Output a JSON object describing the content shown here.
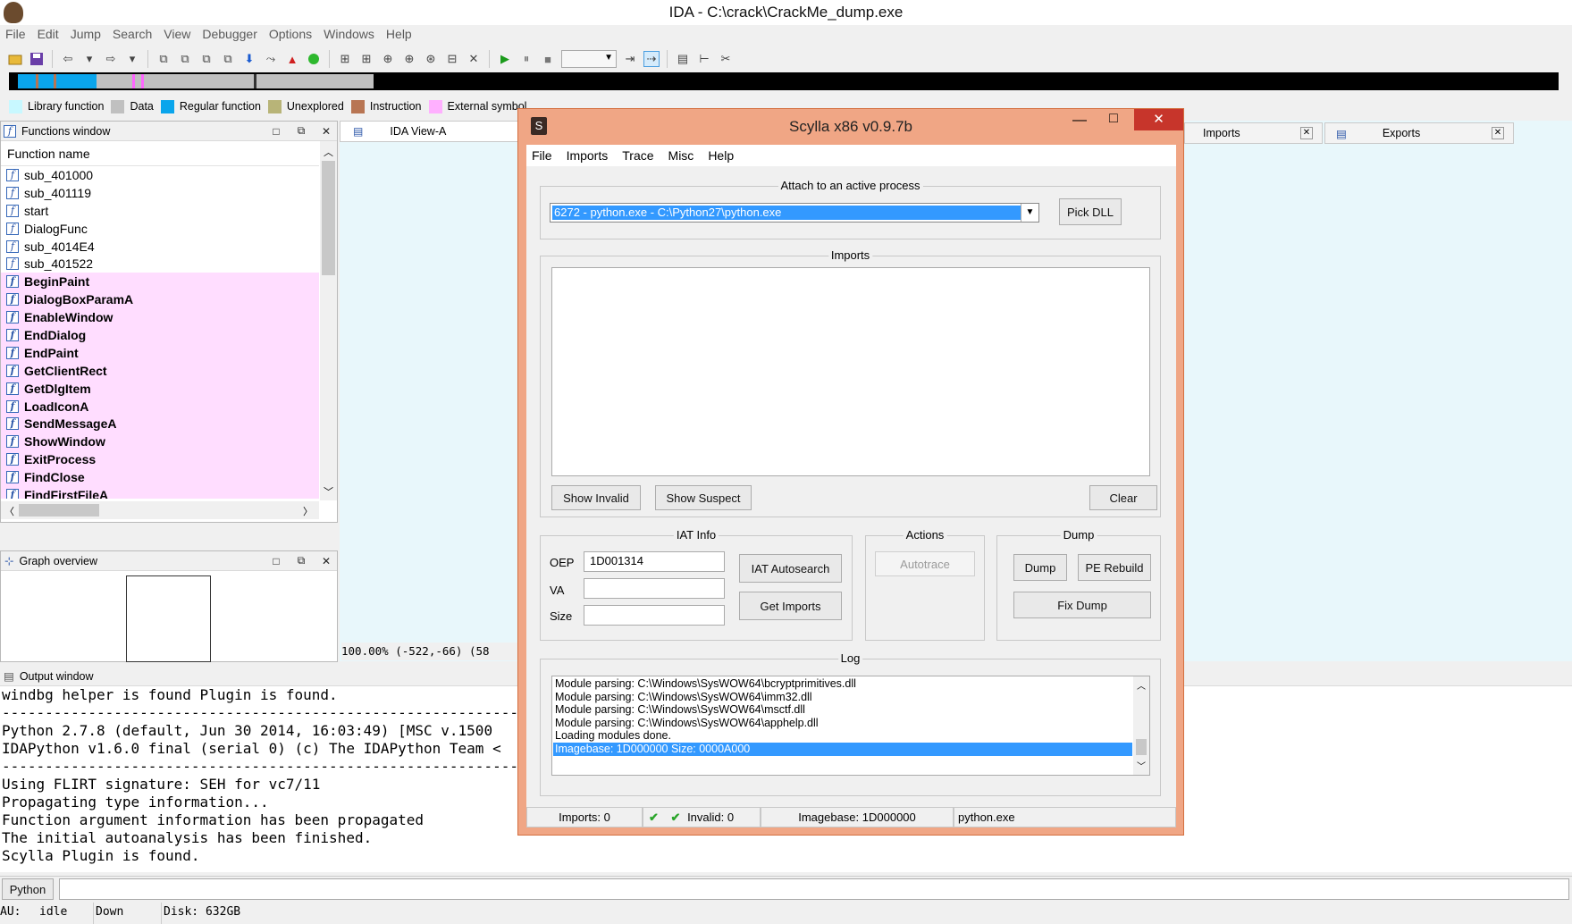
{
  "window": {
    "title": "IDA - C:\\crack\\CrackMe_dump.exe"
  },
  "menu": [
    "File",
    "Edit",
    "Jump",
    "Search",
    "View",
    "Debugger",
    "Options",
    "Windows",
    "Help"
  ],
  "legend": [
    {
      "label": "Library function",
      "color": "#c8f8ff"
    },
    {
      "label": "Data",
      "color": "#c0c0c0"
    },
    {
      "label": "Regular function",
      "color": "#0aa5ec"
    },
    {
      "label": "Unexplored",
      "color": "#b8b478"
    },
    {
      "label": "Instruction",
      "color": "#b87553"
    },
    {
      "label": "External symbol",
      "color": "#ffb0ff"
    }
  ],
  "functions_window": {
    "title": "Functions window",
    "column": "Function name",
    "items": [
      {
        "name": "sub_401000",
        "imported": false
      },
      {
        "name": "sub_401119",
        "imported": false
      },
      {
        "name": "start",
        "imported": false
      },
      {
        "name": "DialogFunc",
        "imported": false
      },
      {
        "name": "sub_4014E4",
        "imported": false
      },
      {
        "name": "sub_401522",
        "imported": false
      },
      {
        "name": "BeginPaint",
        "imported": true
      },
      {
        "name": "DialogBoxParamA",
        "imported": true
      },
      {
        "name": "EnableWindow",
        "imported": true
      },
      {
        "name": "EndDialog",
        "imported": true
      },
      {
        "name": "EndPaint",
        "imported": true
      },
      {
        "name": "GetClientRect",
        "imported": true
      },
      {
        "name": "GetDlgItem",
        "imported": true
      },
      {
        "name": "LoadIconA",
        "imported": true
      },
      {
        "name": "SendMessageA",
        "imported": true
      },
      {
        "name": "ShowWindow",
        "imported": true
      },
      {
        "name": "ExitProcess",
        "imported": true
      },
      {
        "name": "FindClose",
        "imported": true
      },
      {
        "name": "FindFirstFileA",
        "imported": true
      }
    ]
  },
  "graph_overview": {
    "title": "Graph overview"
  },
  "tabs": {
    "ida_view": "IDA View-A",
    "imports": "Imports",
    "exports": "Exports"
  },
  "ida_status": "100.00% (-522,-66) (58",
  "output": {
    "title": "Output window",
    "lines": [
      "windbg helper is found Plugin is found.",
      "---------------------------------------------------------------------------------------",
      "Python 2.7.8 (default, Jun 30 2014, 16:03:49) [MSC v.1500",
      "IDAPython v1.6.0 final (serial 0) (c) The IDAPython Team <",
      "---------------------------------------------------------------------------------------",
      "Using FLIRT signature: SEH for vc7/11",
      "Propagating type information...",
      "Function argument information has been propagated",
      "The initial autoanalysis has been finished.",
      "Scylla Plugin is found."
    ]
  },
  "python_button": "Python",
  "statusbar": {
    "au": "AU:",
    "state": "idle",
    "dir": "Down",
    "disk": "Disk: 632GB"
  },
  "scylla": {
    "title": "Scylla x86 v0.9.7b",
    "menu": [
      "File",
      "Imports",
      "Trace",
      "Misc",
      "Help"
    ],
    "attach_label": "Attach to an active process",
    "process": "6272 - python.exe - C:\\Python27\\python.exe",
    "pick_dll": "Pick DLL",
    "imports_label": "Imports",
    "show_invalid": "Show Invalid",
    "show_suspect": "Show Suspect",
    "clear": "Clear",
    "iat_label": "IAT Info",
    "oep_label": "OEP",
    "oep_value": "1D001314",
    "va_label": "VA",
    "size_label": "Size",
    "iat_autosearch": "IAT Autosearch",
    "get_imports": "Get Imports",
    "actions_label": "Actions",
    "autotrace": "Autotrace",
    "dump_label": "Dump",
    "dump": "Dump",
    "pe_rebuild": "PE Rebuild",
    "fix_dump": "Fix Dump",
    "log_label": "Log",
    "log": [
      "Module parsing: C:\\Windows\\SysWOW64\\bcryptprimitives.dll",
      "Module parsing: C:\\Windows\\SysWOW64\\imm32.dll",
      "Module parsing: C:\\Windows\\SysWOW64\\msctf.dll",
      "Module parsing: C:\\Windows\\SysWOW64\\apphelp.dll",
      "Loading modules done.",
      "Imagebase: 1D000000 Size: 0000A000"
    ],
    "status": {
      "imports": "Imports: 0",
      "invalid": "Invalid: 0",
      "imagebase": "Imagebase: 1D000000",
      "module": "python.exe"
    }
  }
}
